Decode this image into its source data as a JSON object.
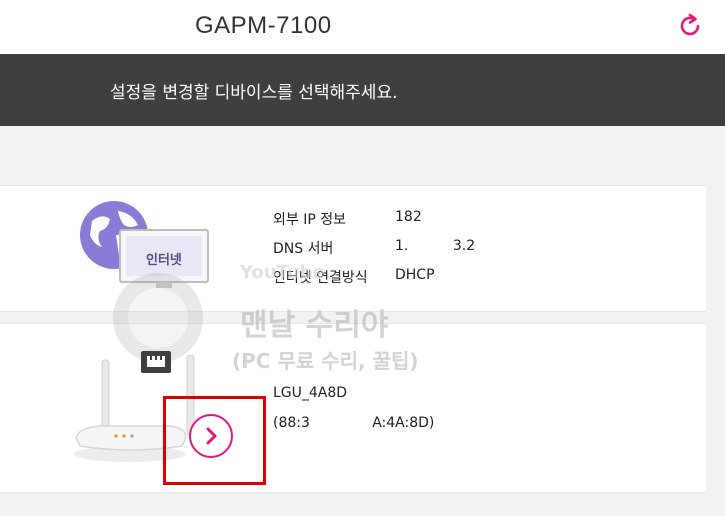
{
  "header": {
    "title": "GAPM-7100",
    "refresh_icon": "refresh-icon"
  },
  "banner": {
    "message": "설정을 변경할 디바이스를 선택해주세요."
  },
  "internet_card": {
    "image_label": "인터넷",
    "rows": [
      {
        "label": "외부 IP 정보",
        "value": "182"
      },
      {
        "label": "DNS 서버",
        "value": "1.          3.2"
      },
      {
        "label": "인터넷 연결방식",
        "value": "DHCP"
      }
    ]
  },
  "router_card": {
    "name": "LGU_4A8D",
    "mac": "(88:3              A:4A:8D)",
    "next_icon": "chevron-right-icon"
  },
  "watermark": {
    "line1": "맨날 수리야",
    "line2": "(PC 무료 수리, 꿀팁)",
    "yt": "YouTube"
  },
  "colors": {
    "accent": "#e5187a",
    "banner_bg": "#3f3f3f",
    "highlight": "#e00000"
  }
}
